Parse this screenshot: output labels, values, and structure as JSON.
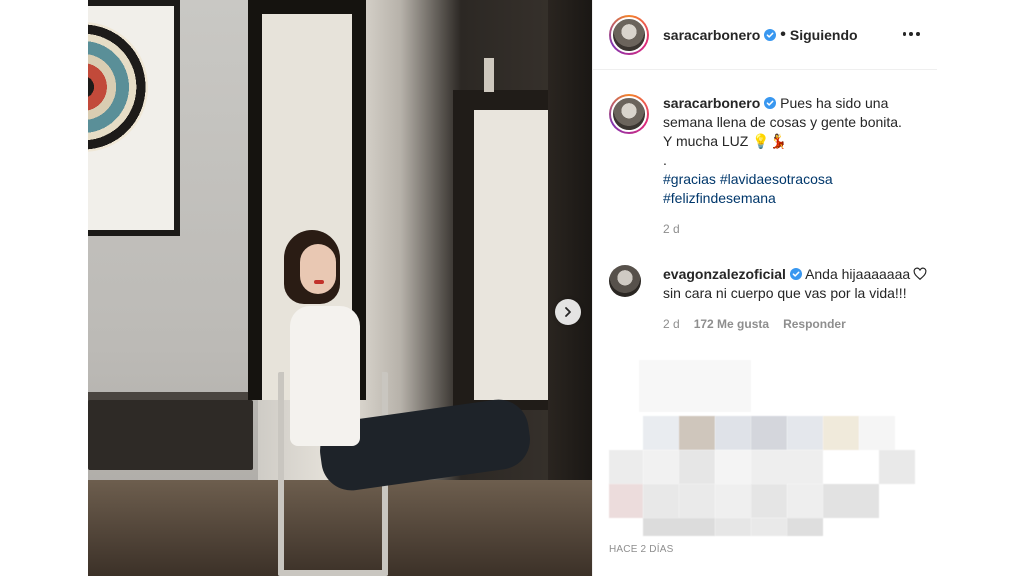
{
  "post": {
    "photo_alt": "",
    "next_icon": "chevron-right-icon"
  },
  "header": {
    "username": "saracarbonero",
    "verified_icon": "verified-badge-icon",
    "separator": "•",
    "follow_status": "Siguiendo",
    "more_icon": "more-options-icon"
  },
  "caption": {
    "username": "saracarbonero",
    "text_line1": "Pues ha sido una semana llena de cosas y gente bonita.",
    "text_line2": "Y mucha LUZ 💡💃",
    "text_dot": ".",
    "hashtags": [
      "#gracias",
      "#lavidaesotracosa",
      "#felizfindesemana"
    ],
    "time": "2 d"
  },
  "comments": [
    {
      "username": "evagonzalezoficial",
      "text": "Anda hijaaaaaaa sin cara ni cuerpo que vas por la vida!!!",
      "time": "2 d",
      "likes": "172 Me gusta",
      "reply_label": "Responder",
      "heart_icon": "heart-icon"
    }
  ],
  "footer": {
    "posted_ago": "HACE 2 DÍAS"
  },
  "colors": {
    "accent_verified": "#3897f0",
    "hashtag": "#00376b",
    "muted": "#8e8e8e"
  }
}
